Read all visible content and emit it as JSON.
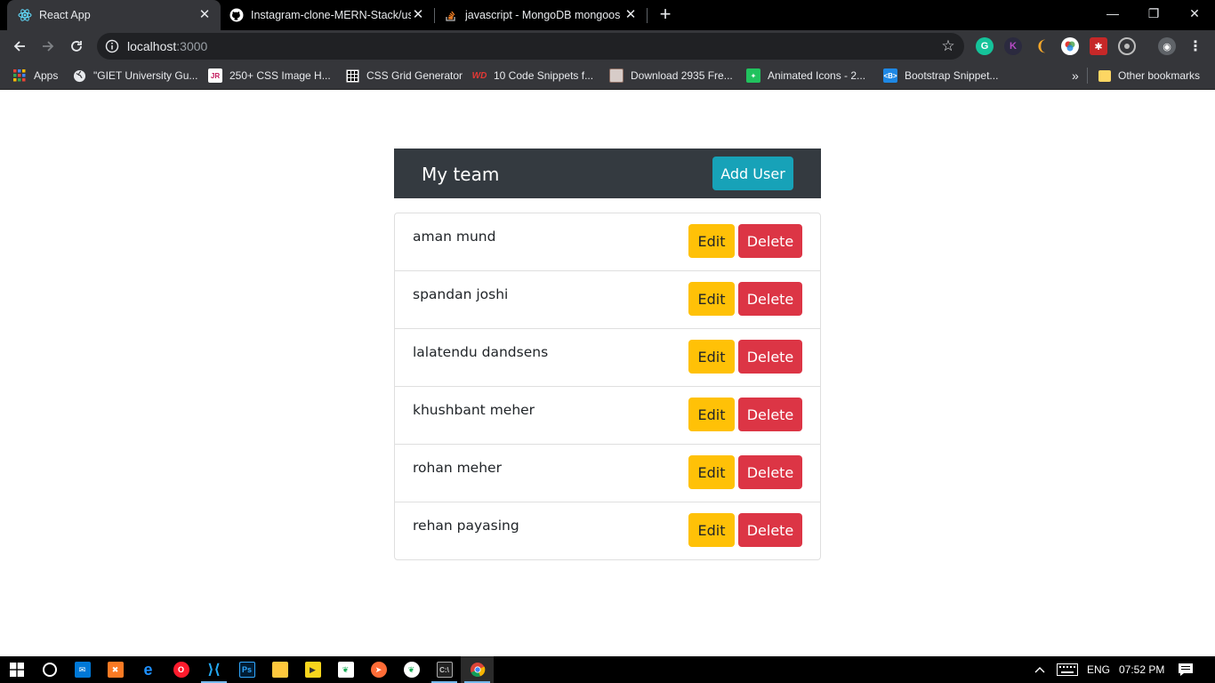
{
  "browser": {
    "tabs": [
      {
        "title": "React App",
        "active": true
      },
      {
        "title": "Instagram-clone-MERN-Stack/us",
        "active": false
      },
      {
        "title": "javascript - MongoDB mongoose",
        "active": false
      }
    ],
    "url_host": "localhost",
    "url_port": ":3000",
    "bookmarks": [
      {
        "label": "Apps",
        "icon": "apps-grid-icon"
      },
      {
        "label": "\"GIET University Gu...",
        "icon": "globe-icon"
      },
      {
        "label": "250+ CSS Image H...",
        "icon": "jr-icon"
      },
      {
        "label": "CSS Grid Generator",
        "icon": "grid-icon"
      },
      {
        "label": "10 Code Snippets f...",
        "icon": "wd-icon"
      },
      {
        "label": "Download 2935 Fre...",
        "icon": "download-site-icon"
      },
      {
        "label": "Animated Icons - 2...",
        "icon": "animated-icons-icon"
      },
      {
        "label": "Bootstrap Snippet...",
        "icon": "bootstrap-icon"
      }
    ],
    "overflow": "»",
    "other_bookmarks": "Other bookmarks"
  },
  "page": {
    "header_title": "My team",
    "add_user_label": "Add User",
    "edit_label": "Edit",
    "delete_label": "Delete",
    "users": [
      {
        "name": "aman mund"
      },
      {
        "name": "spandan joshi"
      },
      {
        "name": "lalatendu dandsens"
      },
      {
        "name": "khushbant meher"
      },
      {
        "name": "rohan meher"
      },
      {
        "name": "rehan payasing"
      }
    ]
  },
  "taskbar": {
    "language": "ENG",
    "time": "07:52 PM"
  },
  "colors": {
    "header_bg": "#343a40",
    "info_btn": "#17a2b8",
    "warning_btn": "#ffc107",
    "danger_btn": "#dc3545"
  }
}
